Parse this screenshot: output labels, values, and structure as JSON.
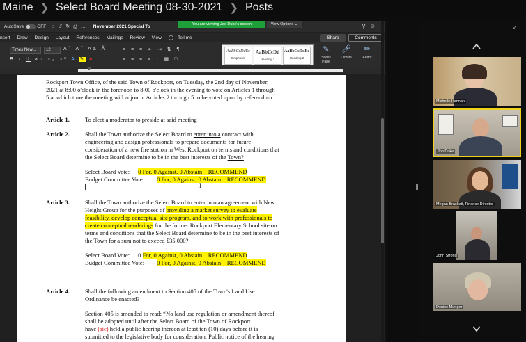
{
  "breadcrumb": [
    "Maine",
    "Select Board Meeting 08-30-2021",
    "Posts"
  ],
  "word": {
    "autosave_label": "AutoSave",
    "autosave_state": "OFF",
    "doc_title": "November 2021 Special To",
    "share_banner": "You are viewing Joe Duke's screen",
    "view_options": "View Options",
    "menu": [
      "nsert",
      "Draw",
      "Design",
      "Layout",
      "References",
      "Mailings",
      "Review",
      "View",
      "Tell me"
    ],
    "share_label": "Share",
    "comments_label": "Comments",
    "font_name": "Times New...",
    "font_size": "12",
    "styles": [
      {
        "sample": "AaBbCcDdEe",
        "name": "Emphasis"
      },
      {
        "sample": "AaBbCcDd",
        "name": "Heading 1"
      },
      {
        "sample": "AaBbCcDdEe",
        "name": "Heading 2"
      }
    ],
    "tools": [
      {
        "name": "Styles Pane",
        "icon": "styles-pane-icon"
      },
      {
        "name": "Dictate",
        "icon": "microphone-icon"
      },
      {
        "name": "Editor",
        "icon": "editor-pen-icon"
      }
    ]
  },
  "document": {
    "intro": [
      "Rockport Town Office, of the said Town of Rockport, on Tuesday, the 2nd day of November,",
      "2021 at 8:00 o'clock in the forenoon to 8:00 o'clock in the evening to vote on Articles 1 through",
      "5 at which time the meeting will adjourn. Articles 2 through 5 to be voted upon by referendum."
    ],
    "article1": {
      "label": "Article 1.",
      "text": "To elect a moderator to preside at said meeting"
    },
    "article2": {
      "label": "Article 2.",
      "line1_pre": "Shall the Town authorize the Select Board to ",
      "line1_u": "enter into a",
      "line1_post": " contract with",
      "line2": "engineering and design professionals to prepare documents for future",
      "line3": "consideration of a new fire station in West Rockport on terms and conditions that",
      "line4_pre": "the Select Board determine to be in the best interests of the ",
      "line4_u": "Town?",
      "sb_vote_label": "Select Board Vote:",
      "sb_vote_value": "0 For, 0 Against, 0 Abstain    RECOMMEND",
      "bc_vote_label": "Budget Committee Vote:",
      "bc_vote_value": "0 For, 0 Against, 0 Abstain    RECOMMEND"
    },
    "article3": {
      "label": "Article 3.",
      "line1": "Shall the Town authorize the Select Board to enter into an agreement with New",
      "line2_pre": "Height Group for the purposes of ",
      "line2_hl": "providing a market survey to evaluate",
      "line3_hl": "feasibility, develop conceptual site program, and to work with professionals to",
      "line4_hl": "create conceptual renderings",
      "line4_post": " for the former Rockport Elementary School site on",
      "line5": "terms and conditions that the Select Board determine to be in the best interests of",
      "line6": "the Town for a sum not to exceed $35,000?",
      "sb_vote_label": "Select Board Vote:",
      "sb_vote_pre": "0 ",
      "sb_vote_hl": "For, 0 Against, 0 Abstain    RECOMMEND",
      "bc_vote_label": "Budget Committee Vote:",
      "bc_vote_value": "0 For, 0 Against, 0 Abstain    RECOMMEND"
    },
    "article4": {
      "label": "Article 4.",
      "line1": "Shall the following amendment to Section 405 of the Town's Land Use",
      "line2": "Ordinance be enacted?",
      "s1": "Section 405 is amended to read: “No land use regulation or amendment thereof",
      "s2": "shall be adopted until after the Select Board of the Town of Rockport",
      "s3_pre": "have ",
      "s3_sic": "(sic)",
      "s3_post": " held a public hearing thereon at least ten (10) days before it is",
      "s4": "submitted to the legislative body for consideration.  Public notice of the hearing"
    }
  },
  "participants": [
    {
      "name": "Michelle Hannan",
      "active": false
    },
    {
      "name": "Jon Duke",
      "active": true
    },
    {
      "name": "Megan Brackett, Finance Director",
      "active": false
    },
    {
      "name": "John Strond",
      "active": false
    },
    {
      "name": "Denise Munger",
      "active": false
    }
  ],
  "gallery_tab": "Vi",
  "colors": {
    "highlight": "#fff200",
    "active_speaker": "#f0d21c",
    "share_banner": "#1ea03a"
  }
}
